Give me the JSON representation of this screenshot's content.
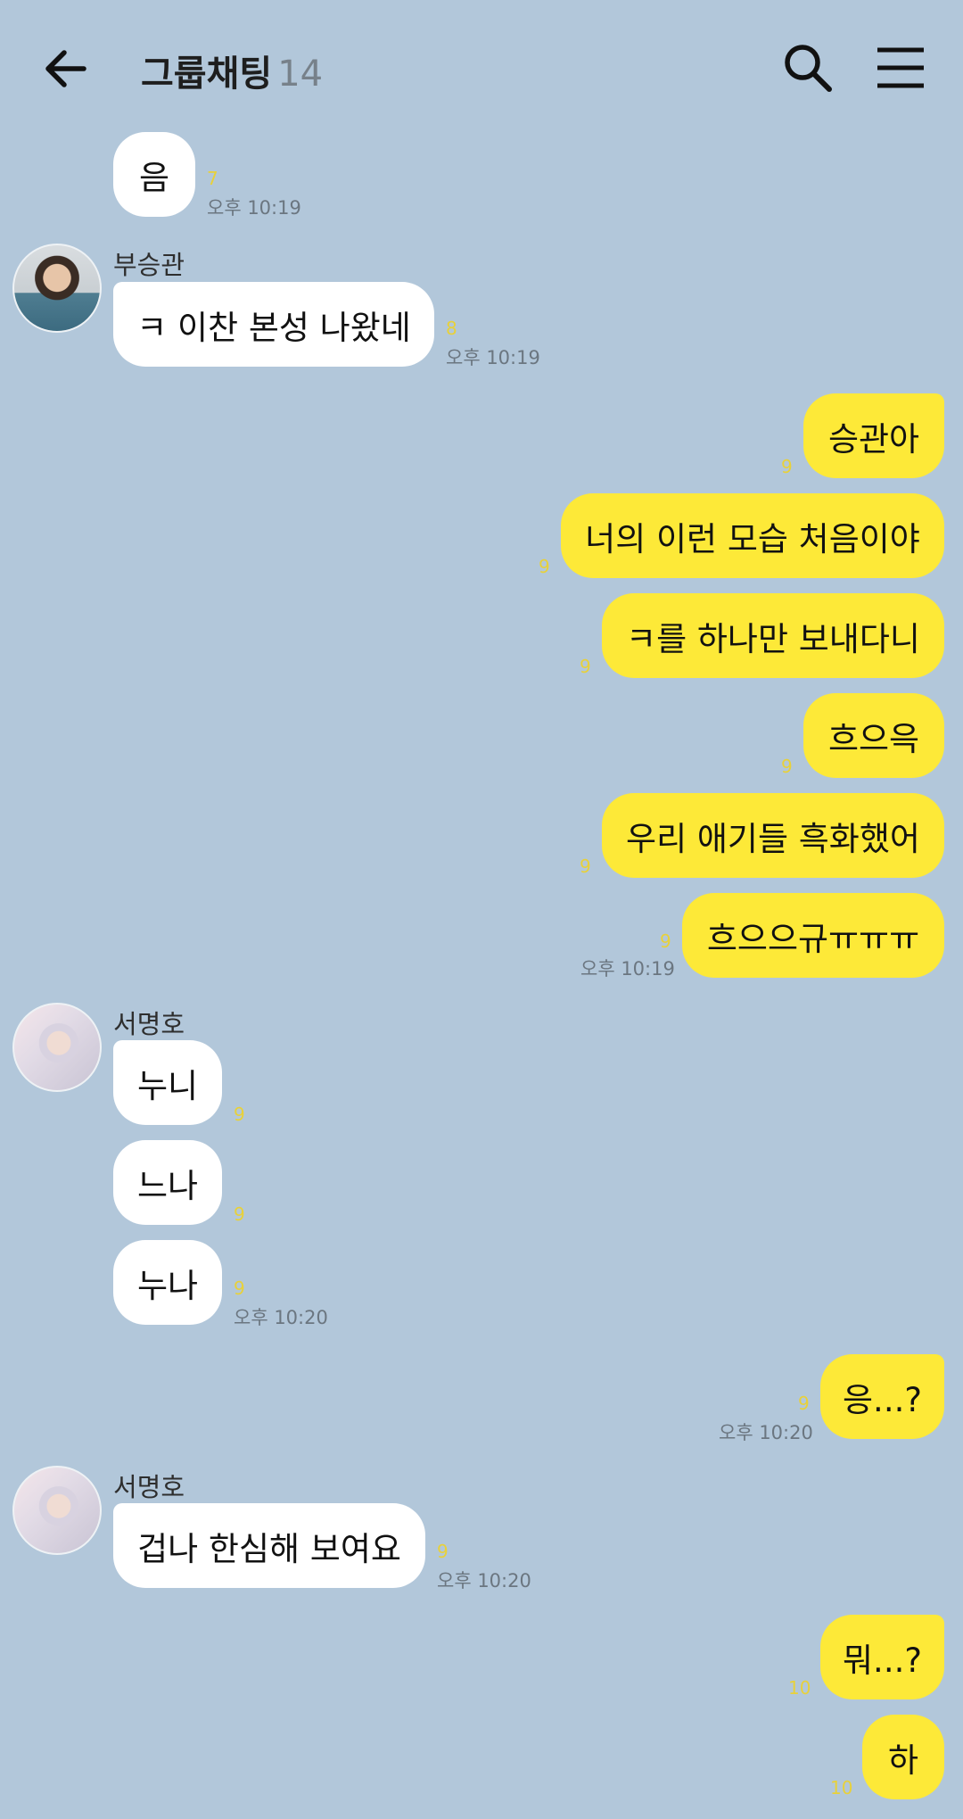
{
  "header": {
    "title": "그룹채팅",
    "member_count": "14"
  },
  "messages": [
    {
      "text": "음",
      "unread": "7",
      "time": "오후 10:19"
    },
    {
      "sender": "부승관",
      "text": "ㅋ 이찬 본성 나왔네",
      "unread": "8",
      "time": "오후 10:19"
    },
    {
      "text": "승관아",
      "unread": "9"
    },
    {
      "text": "너의 이런 모습 처음이야",
      "unread": "9"
    },
    {
      "text": "ㅋ를 하나만 보내다니",
      "unread": "9"
    },
    {
      "text": "흐으윽",
      "unread": "9"
    },
    {
      "text": "우리 애기들 흑화했어",
      "unread": "9"
    },
    {
      "text": "흐으으규ㅠㅠㅠ",
      "unread": "9",
      "time": "오후 10:19"
    },
    {
      "sender": "서명호",
      "text": "누니",
      "unread": "9"
    },
    {
      "text": "느나",
      "unread": "9"
    },
    {
      "text": "누나",
      "unread": "9",
      "time": "오후 10:20"
    },
    {
      "text": "응...?",
      "unread": "9",
      "time": "오후 10:20"
    },
    {
      "sender": "서명호",
      "text": "겁나 한심해 보여요",
      "unread": "9",
      "time": "오후 10:20"
    },
    {
      "text": "뭐...?",
      "unread": "10"
    },
    {
      "text": "하",
      "unread": "10"
    }
  ],
  "colors": {
    "background": "#b2c7da",
    "outgoing": "#fde938",
    "incoming": "#ffffff",
    "unread": "#e8d13a"
  },
  "icons": {
    "back": "arrow-left-icon",
    "search": "search-icon",
    "menu": "hamburger-menu-icon"
  }
}
